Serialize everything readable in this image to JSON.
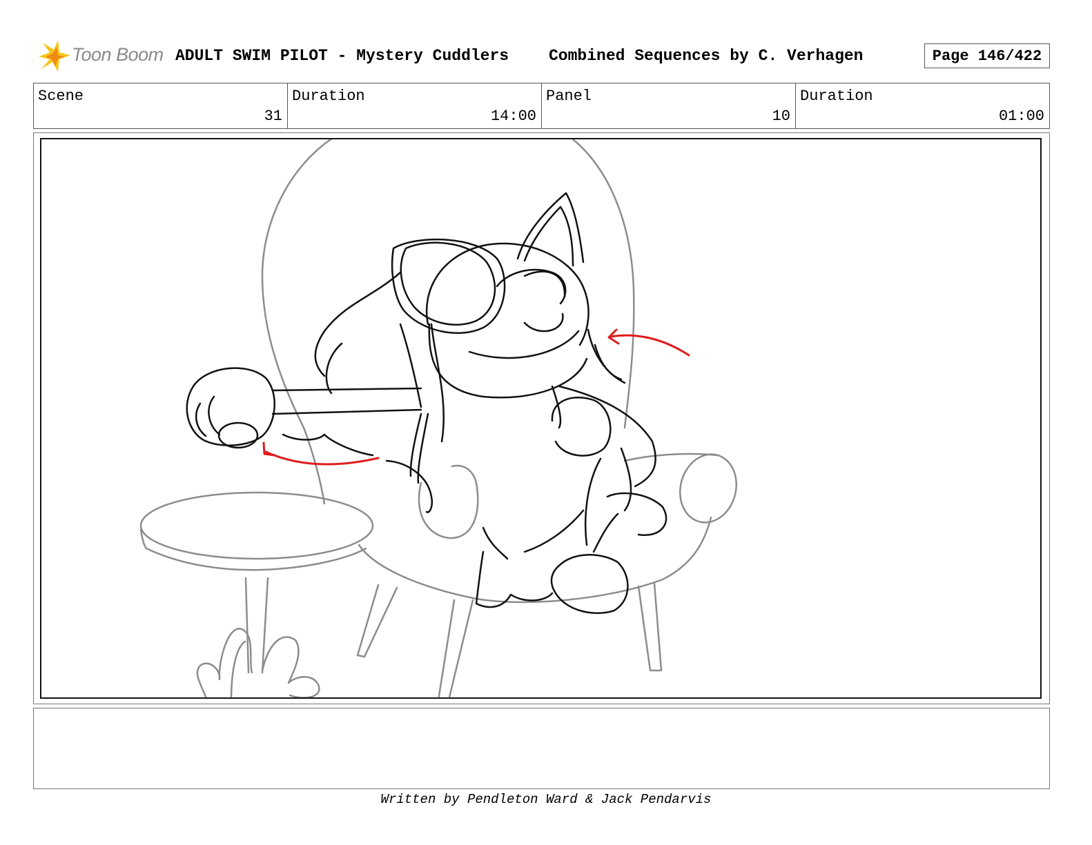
{
  "header": {
    "logo_text": "Toon Boom",
    "title": "ADULT SWIM PILOT - Mystery Cuddlers",
    "subtitle": "Combined Sequences by C. Verhagen",
    "page": "Page 146/422"
  },
  "info": {
    "scene_label": "Scene",
    "scene_value": "31",
    "scene_duration_label": "Duration",
    "scene_duration_value": "14:00",
    "panel_label": "Panel",
    "panel_value": "10",
    "panel_duration_label": "Duration",
    "panel_duration_value": "01:00"
  },
  "panel": {
    "sketch_color": "#111111",
    "furniture_color": "#8c8c8c",
    "arrow_color": "#e01b1b"
  },
  "footer": {
    "credit": "Written by Pendleton Ward & Jack Pendarvis"
  }
}
